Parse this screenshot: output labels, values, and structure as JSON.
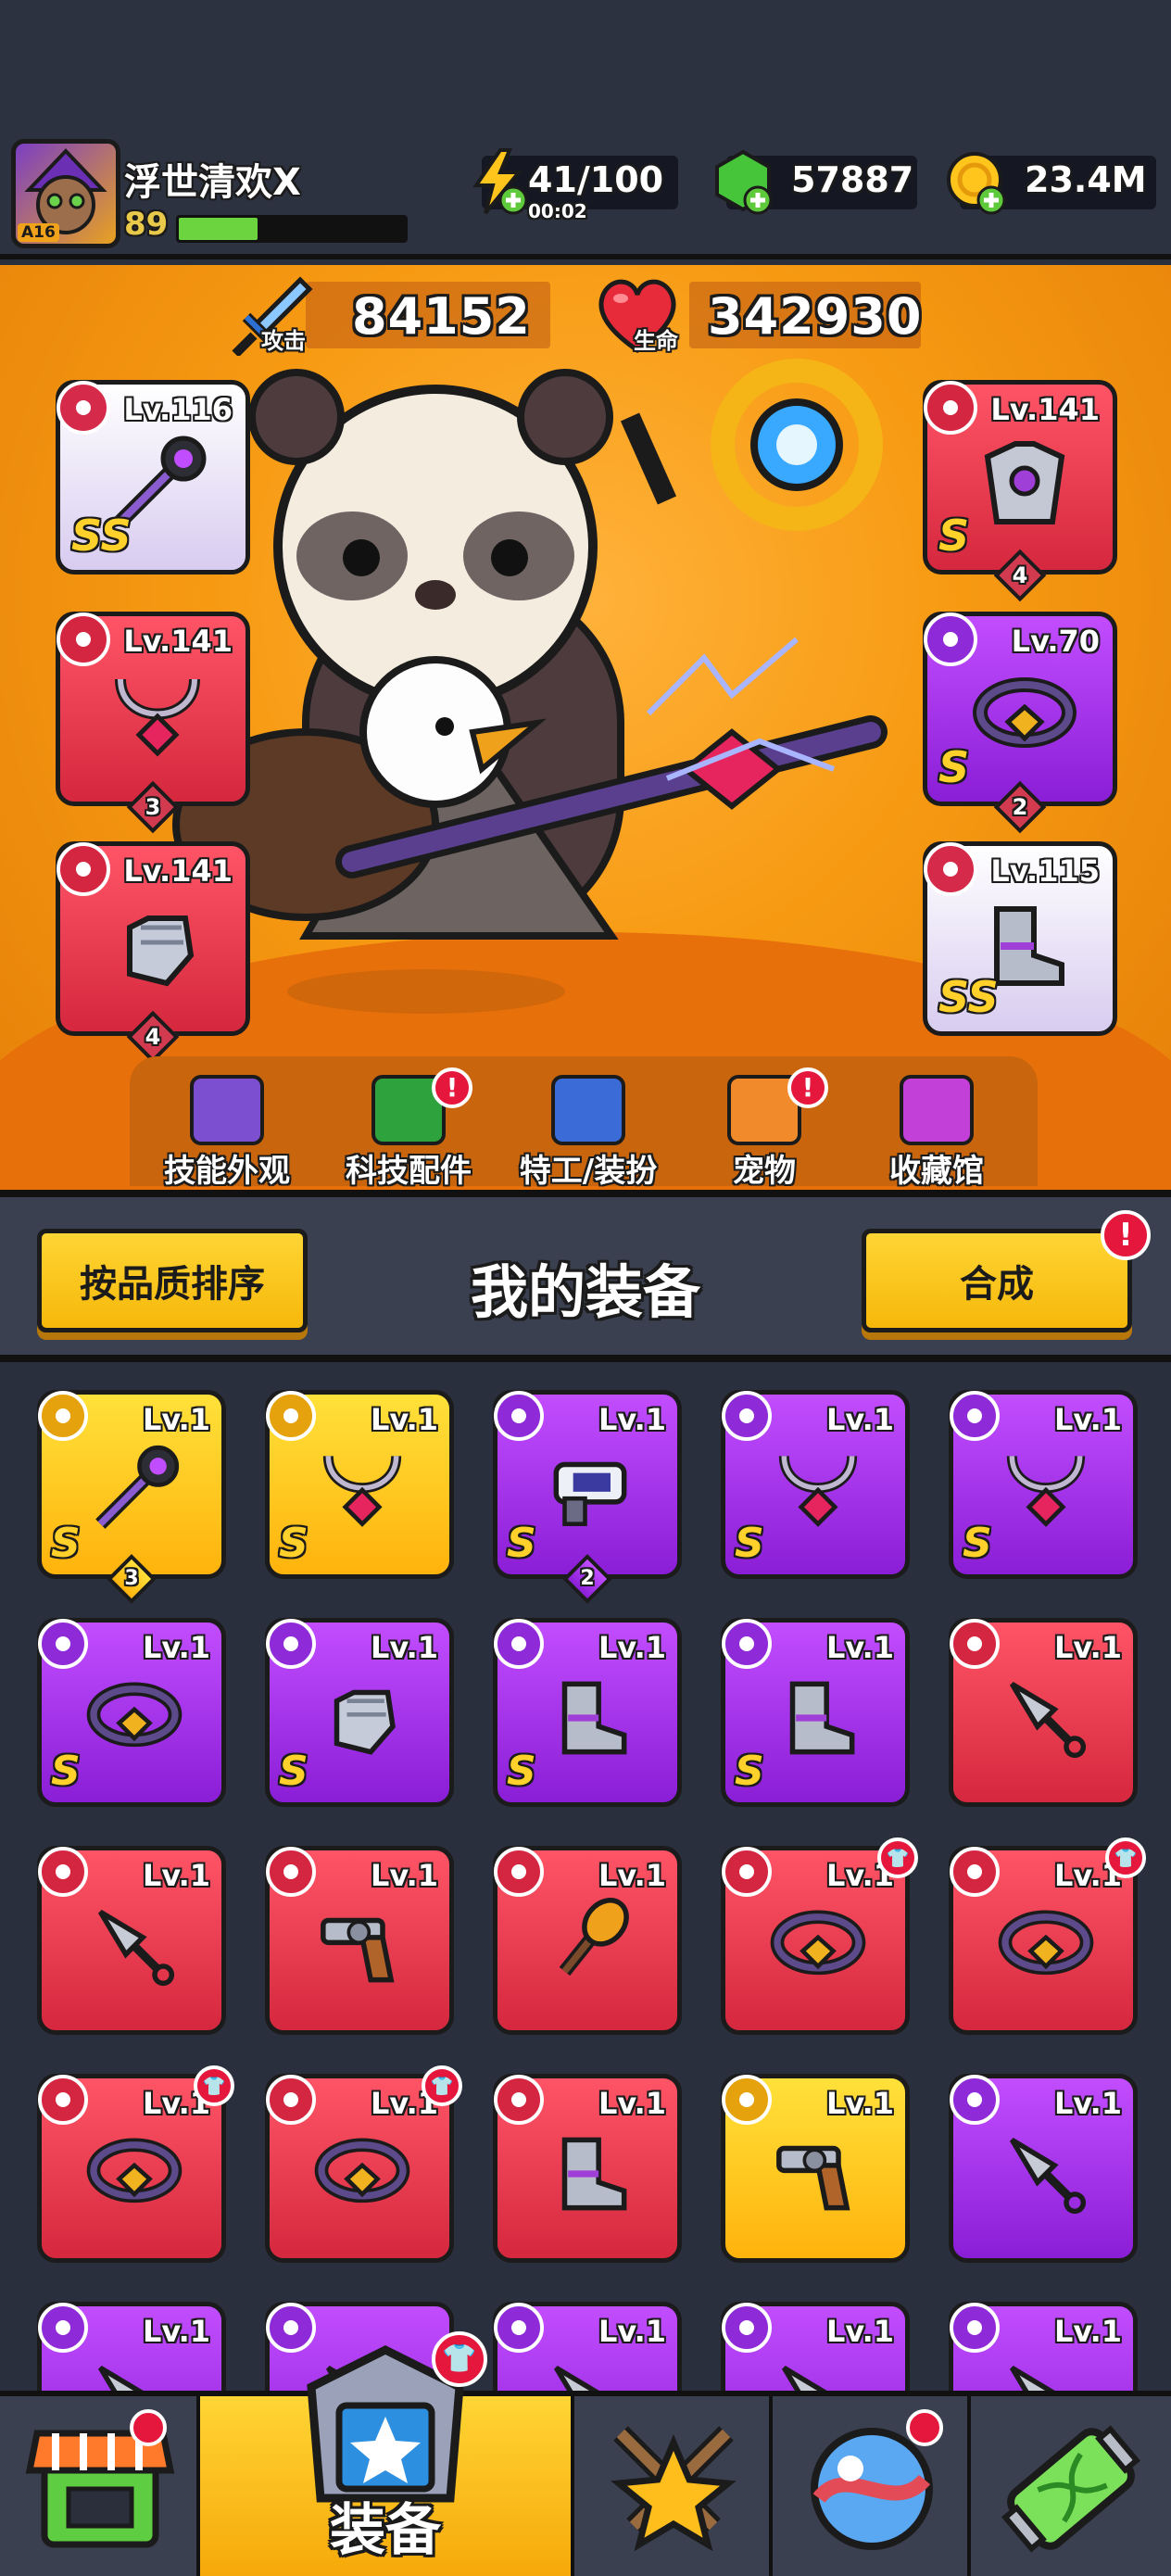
{
  "player": {
    "name": "浮世清欢X",
    "level": "89",
    "avatar_tag": "A16",
    "xp_fraction": 0.35
  },
  "resources": {
    "energy": {
      "value": "41/100",
      "timer": "00:02",
      "icon": "lightning-icon"
    },
    "gems": {
      "value": "57887",
      "icon": "green-gem-icon"
    },
    "gold": {
      "value": "23.4M",
      "icon": "gold-coin-icon"
    }
  },
  "stats": {
    "attack": {
      "value": "84152",
      "label": "攻击"
    },
    "hp": {
      "value": "342930",
      "label": "生命"
    }
  },
  "equipped": [
    {
      "slot": "weapon",
      "level": "Lv.116",
      "grade": "SS",
      "rarity": "white",
      "icon": "wand-icon",
      "stars": ""
    },
    {
      "slot": "necklace",
      "level": "Lv.141",
      "grade": "",
      "rarity": "red",
      "icon": "necklace-icon",
      "stars": "3"
    },
    {
      "slot": "gloves",
      "level": "Lv.141",
      "grade": "",
      "rarity": "red",
      "icon": "glove-icon",
      "stars": "4"
    },
    {
      "slot": "armor",
      "level": "Lv.141",
      "grade": "S",
      "rarity": "red",
      "icon": "armor-icon",
      "stars": "4"
    },
    {
      "slot": "belt",
      "level": "Lv.70",
      "grade": "S",
      "rarity": "purple",
      "icon": "belt-icon",
      "stars": "2"
    },
    {
      "slot": "boots",
      "level": "Lv.115",
      "grade": "SS",
      "rarity": "white",
      "icon": "boot-icon",
      "stars": ""
    }
  ],
  "submenu": [
    {
      "label": "技能外观",
      "icon": "skill-skin-icon",
      "badge": false
    },
    {
      "label": "科技配件",
      "icon": "tech-part-icon",
      "badge": true
    },
    {
      "label": "特工/装扮",
      "icon": "agent-icon",
      "badge": false
    },
    {
      "label": "宠物",
      "icon": "pet-icon",
      "badge": true
    },
    {
      "label": "收藏馆",
      "icon": "collection-icon",
      "badge": false
    }
  ],
  "equipment_section": {
    "title": "我的装备",
    "sort_button": "按品质排序",
    "merge_button": "合成",
    "merge_badge": "!"
  },
  "inventory": [
    {
      "level": "Lv.1",
      "grade": "S",
      "rarity": "gold",
      "icon": "wand-icon",
      "stars": "3",
      "corner": false
    },
    {
      "level": "Lv.1",
      "grade": "S",
      "rarity": "gold",
      "icon": "necklace-icon",
      "stars": "",
      "corner": false
    },
    {
      "level": "Lv.1",
      "grade": "S",
      "rarity": "purple",
      "icon": "blaster-icon",
      "stars": "2",
      "corner": false
    },
    {
      "level": "Lv.1",
      "grade": "S",
      "rarity": "purple",
      "icon": "necklace-icon",
      "stars": "",
      "corner": false
    },
    {
      "level": "Lv.1",
      "grade": "S",
      "rarity": "purple",
      "icon": "necklace-icon",
      "stars": "",
      "corner": false
    },
    {
      "level": "Lv.1",
      "grade": "S",
      "rarity": "purple",
      "icon": "belt-icon",
      "stars": "",
      "corner": false
    },
    {
      "level": "Lv.1",
      "grade": "S",
      "rarity": "purple",
      "icon": "glove-icon",
      "stars": "",
      "corner": false
    },
    {
      "level": "Lv.1",
      "grade": "S",
      "rarity": "purple",
      "icon": "boot-icon",
      "stars": "",
      "corner": false
    },
    {
      "level": "Lv.1",
      "grade": "S",
      "rarity": "purple",
      "icon": "boot-icon",
      "stars": "",
      "corner": false
    },
    {
      "level": "Lv.1",
      "grade": "",
      "rarity": "red",
      "icon": "kunai-icon",
      "stars": "",
      "corner": false
    },
    {
      "level": "Lv.1",
      "grade": "",
      "rarity": "red",
      "icon": "kunai-icon",
      "stars": "",
      "corner": false
    },
    {
      "level": "Lv.1",
      "grade": "",
      "rarity": "red",
      "icon": "revolver-icon",
      "stars": "",
      "corner": false
    },
    {
      "level": "Lv.1",
      "grade": "",
      "rarity": "red",
      "icon": "torch-icon",
      "stars": "",
      "corner": false
    },
    {
      "level": "Lv.1",
      "grade": "",
      "rarity": "red",
      "icon": "belt-icon",
      "stars": "",
      "corner": true
    },
    {
      "level": "Lv.1",
      "grade": "",
      "rarity": "red",
      "icon": "belt-icon",
      "stars": "",
      "corner": true
    },
    {
      "level": "Lv.1",
      "grade": "",
      "rarity": "red",
      "icon": "belt-icon",
      "stars": "",
      "corner": true
    },
    {
      "level": "Lv.1",
      "grade": "",
      "rarity": "red",
      "icon": "belt-icon",
      "stars": "",
      "corner": true
    },
    {
      "level": "Lv.1",
      "grade": "",
      "rarity": "red",
      "icon": "boot-icon",
      "stars": "",
      "corner": false
    },
    {
      "level": "Lv.1",
      "grade": "",
      "rarity": "gold",
      "icon": "revolver-icon",
      "stars": "",
      "corner": false
    },
    {
      "level": "Lv.1",
      "grade": "",
      "rarity": "purple",
      "icon": "kunai-icon",
      "stars": "",
      "corner": false
    },
    {
      "level": "Lv.1",
      "grade": "",
      "rarity": "purple",
      "icon": "kunai-icon",
      "stars": "",
      "corner": false
    },
    {
      "level": "",
      "grade": "",
      "rarity": "purple",
      "icon": "kunai-icon",
      "stars": "",
      "corner": false
    },
    {
      "level": "Lv.1",
      "grade": "",
      "rarity": "purple",
      "icon": "kunai-icon",
      "stars": "",
      "corner": false
    },
    {
      "level": "Lv.1",
      "grade": "",
      "rarity": "purple",
      "icon": "kunai-icon",
      "stars": "",
      "corner": false
    },
    {
      "level": "Lv.1",
      "grade": "",
      "rarity": "purple",
      "icon": "kunai-icon",
      "stars": "",
      "corner": false
    }
  ],
  "bottom_nav": [
    {
      "name": "shop",
      "icon": "shop-icon",
      "label": "",
      "badge": false
    },
    {
      "name": "equipment",
      "icon": "equipment-icon",
      "label": "装备",
      "badge": true,
      "active": true
    },
    {
      "name": "battle",
      "icon": "battle-icon",
      "label": "",
      "badge": false
    },
    {
      "name": "world",
      "icon": "planet-icon",
      "label": "",
      "badge": true
    },
    {
      "name": "evolve",
      "icon": "dna-battery-icon",
      "label": "",
      "badge": false
    }
  ]
}
